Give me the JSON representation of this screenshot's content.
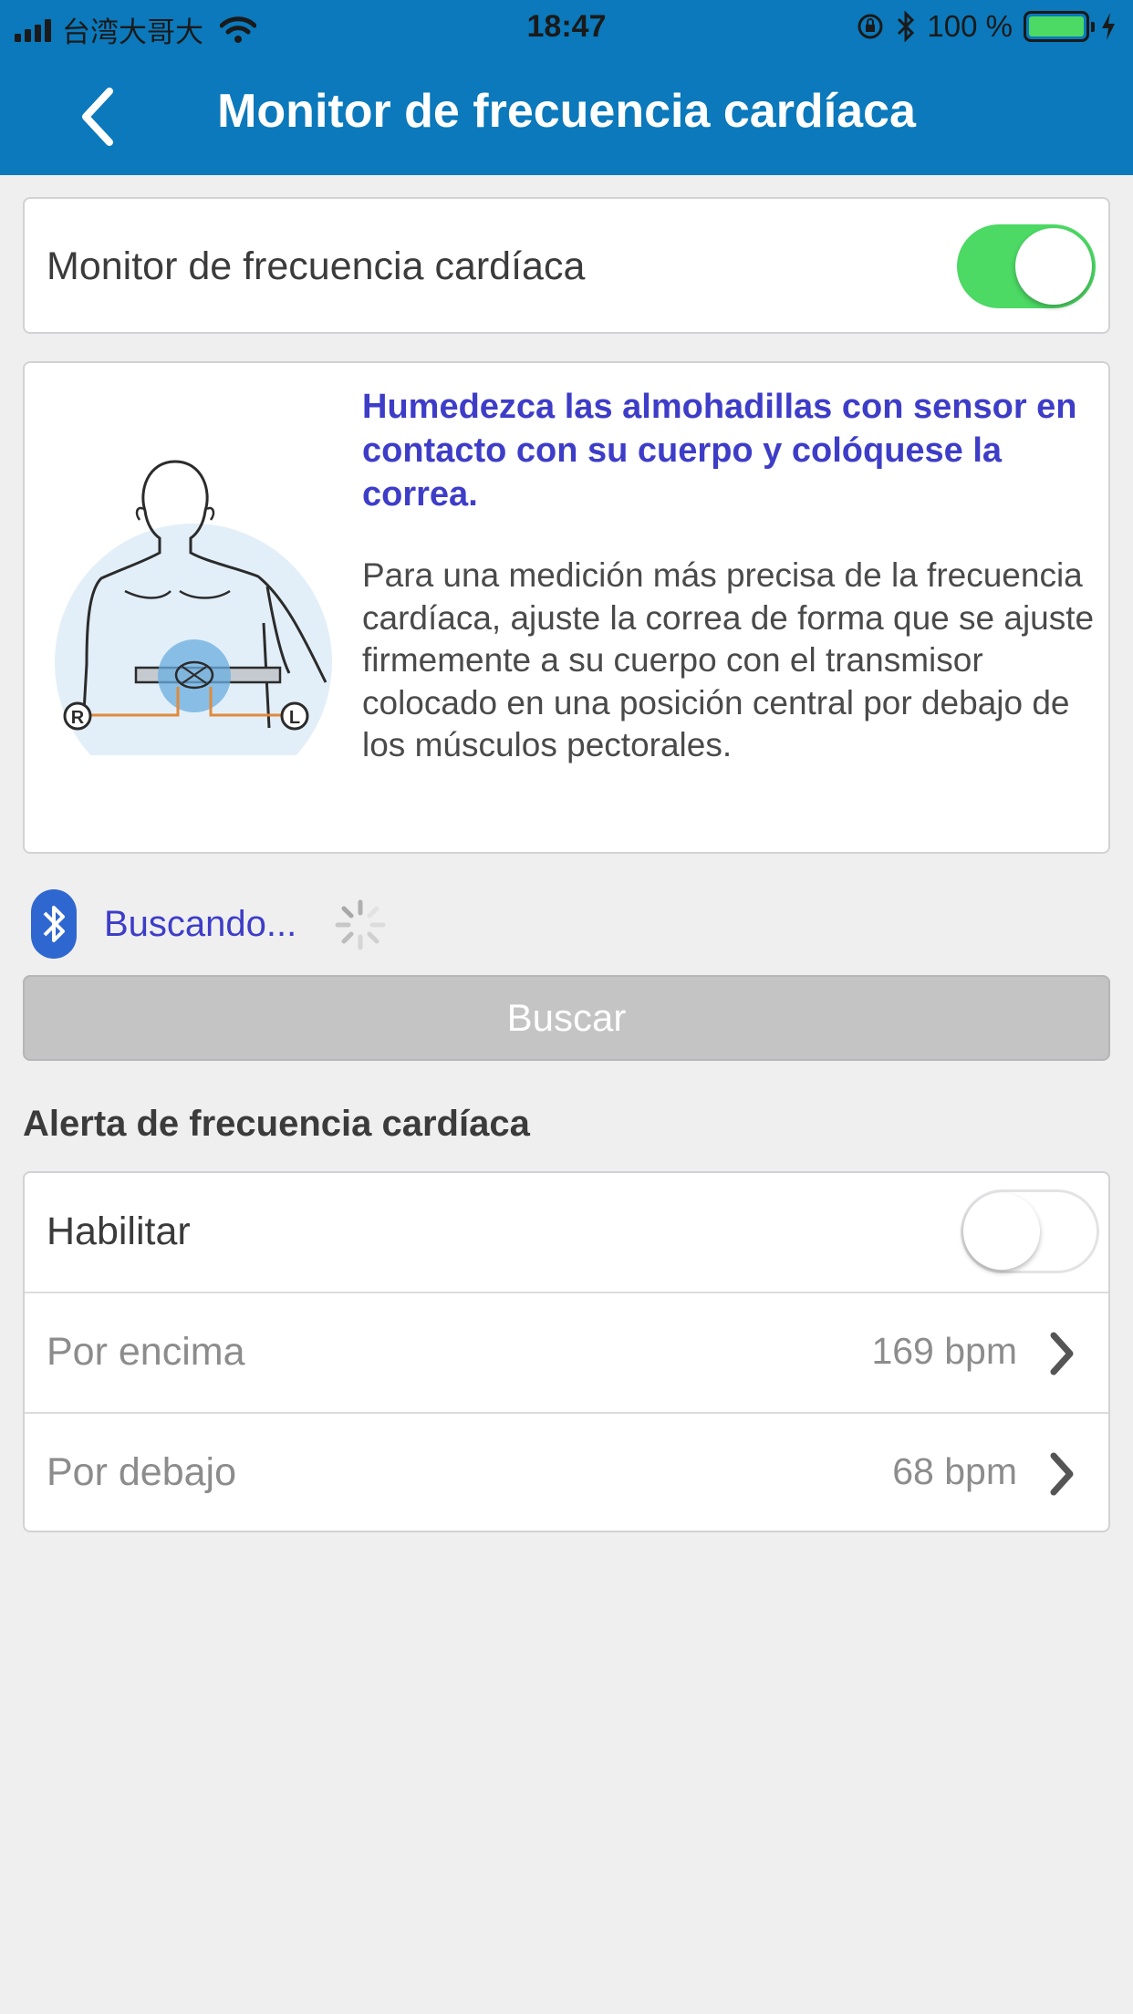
{
  "status_bar": {
    "carrier": "台湾大哥大",
    "time": "18:47",
    "battery": "100 %"
  },
  "nav": {
    "title": "Monitor de frecuencia cardíaca"
  },
  "monitor_toggle": {
    "label": "Monitor de frecuencia cardíaca",
    "state": "on"
  },
  "instructions": {
    "heading": "Humedezca las almohadillas con sensor en contacto con su cuerpo y colóquese la correa.",
    "body": "Para una medición más precisa de la frecuencia cardíaca, ajuste la correa de forma que se ajuste firmemente a su cuerpo con el transmisor colocado en una posición central por debajo de los músculos pectorales.",
    "illustration_labels": {
      "right": "R",
      "left": "L"
    }
  },
  "search": {
    "status": "Buscando...",
    "button_label": "Buscar"
  },
  "alert": {
    "section_title": "Alerta de frecuencia cardíaca",
    "enable_label": "Habilitar",
    "enable_state": "off",
    "above_label": "Por encima",
    "above_value": "169 bpm",
    "below_label": "Por debajo",
    "below_value": "68 bpm"
  },
  "colors": {
    "nav_bar": "#0b79bb",
    "accent_text": "#3e3dc8",
    "toggle_on": "#4cd964",
    "button_disabled": "#c4c4c4",
    "background": "#efeff0"
  }
}
